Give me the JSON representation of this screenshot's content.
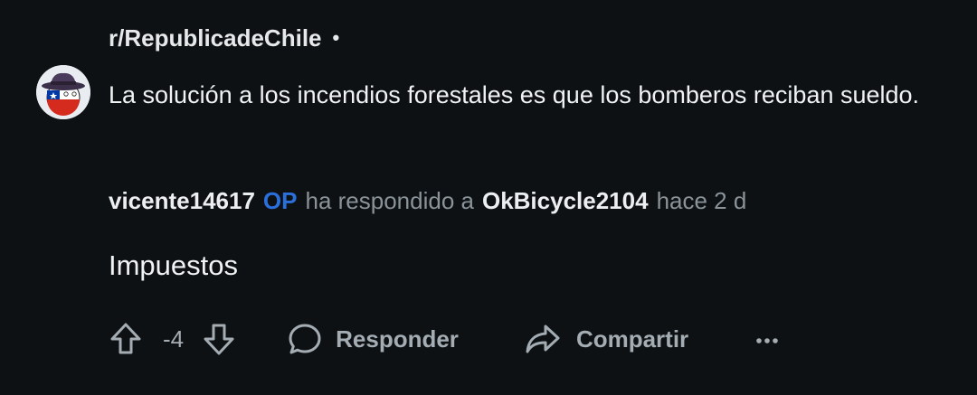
{
  "subreddit": {
    "name": "r/RepublicadeChile",
    "separator": "•"
  },
  "post": {
    "title": "La solución a los incendios forestales es que los bomberos reciban sueldo."
  },
  "comment": {
    "author": "vicente14617",
    "op_badge": "OP",
    "replied_to_text": "ha respondido a",
    "parent_author": "OkBicycle2104",
    "time": "hace 2 d",
    "body": "Impuestos"
  },
  "actions": {
    "score": "-4",
    "reply_label": "Responder",
    "share_label": "Compartir",
    "upvote_icon": "arrow-up-icon",
    "downvote_icon": "arrow-down-icon",
    "reply_icon": "speech-bubble-icon",
    "share_icon": "share-arrow-icon",
    "more_icon": "ellipsis-icon"
  },
  "colors": {
    "background": "#0e1113",
    "op_badge": "#2a6fdb",
    "muted_text": "#8a9399"
  }
}
